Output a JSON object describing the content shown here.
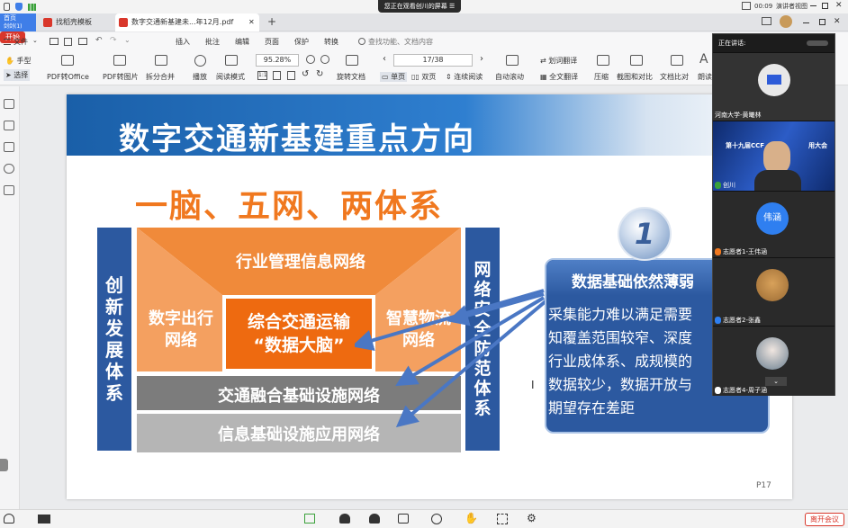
{
  "system": {
    "notice": "您正在观看创川的屏幕",
    "clock": "00:09",
    "presenter_view": "演讲者视图"
  },
  "tabs": {
    "home": "首页",
    "home_sub": "剑剑(1)",
    "template": "找稻壳模板",
    "pdf": "数字交通新基建未...年12月.pdf"
  },
  "menu": {
    "file": "文件",
    "start": "开始",
    "insert": "插入",
    "annotate": "批注",
    "edit": "编辑",
    "page": "页面",
    "protect": "保护",
    "convert": "转换",
    "search": "查找功能、文档内容"
  },
  "ribbon": {
    "hand": "手型",
    "select": "选择",
    "pdf2office": "PDF转Office",
    "pdf2img": "PDF转图片",
    "split_merge": "拆分合并",
    "play": "播放",
    "read_mode": "阅读模式",
    "zoom": "95.28%",
    "rotate": "旋转文档",
    "page": "17/38",
    "single": "单页",
    "double": "双页",
    "continuous": "连续阅读",
    "auto_scroll": "自动滚动",
    "translate_word": "划词翻译",
    "translate_all": "全文翻译",
    "compress": "压缩",
    "screenshot": "截图和对比",
    "compare": "文档比对",
    "read_aloud": "朗读"
  },
  "slide": {
    "title": "数字交通新基建重点方向",
    "subtitle": "一脑、五网、两体系",
    "left_col": [
      "创",
      "新",
      "发",
      "展",
      "体",
      "系"
    ],
    "right_col": [
      "网",
      "络",
      "安",
      "全",
      "防",
      "范",
      "体",
      "系"
    ],
    "top_cell": "行业管理信息网络",
    "left_cell": [
      "数字出行",
      "网络"
    ],
    "center_cell": [
      "综合交通运输",
      "“数据大脑”"
    ],
    "right_cell": [
      "智慧物流",
      "网络"
    ],
    "row1": "交通融合基础设施网络",
    "row2": "信息基础设施应用网络",
    "badge": "1",
    "callout_title": "数据基础依然薄弱",
    "callout_lines": [
      "采集能力难以满足需要",
      "知覆盖范围较窄、深度",
      "行业成体系、成规模的",
      "数据较少，数据开放与",
      "期望存在差距"
    ],
    "page_label": "P17"
  },
  "meeting": {
    "header": "正在讲话:",
    "tiles": [
      {
        "name": "河南大学-黄曦林"
      },
      {
        "name": "创川",
        "banner": "第十九届CCF",
        "banner2": "用大会"
      },
      {
        "name": "志愿者1-王伟涵",
        "avatar_text": "伟涵"
      },
      {
        "name": "志愿者2-张鑫"
      },
      {
        "name": "志愿者4-周子涵"
      }
    ]
  },
  "bottom": {
    "leave": "离开会议"
  },
  "colors": {
    "orange": "#f0781f",
    "blue": "#2c59a0",
    "red": "#d9372b"
  }
}
